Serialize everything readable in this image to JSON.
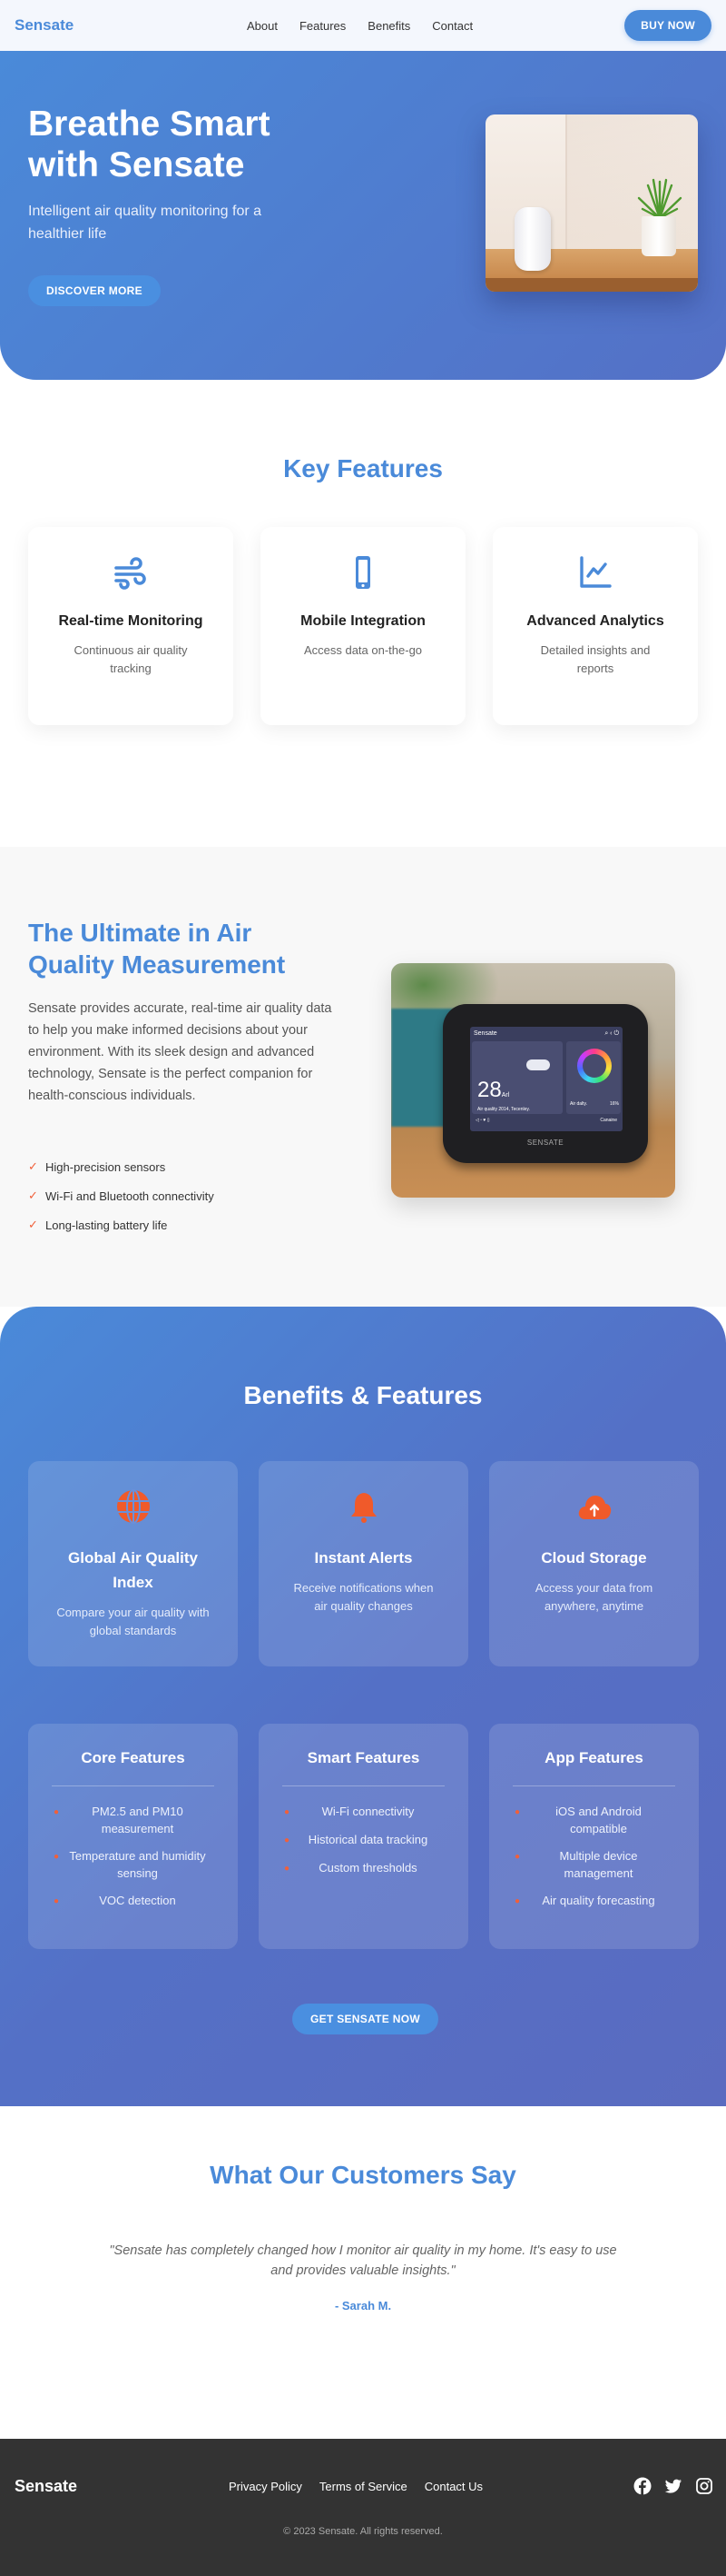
{
  "nav": {
    "logo": "Sensate",
    "links": [
      "About",
      "Features",
      "Benefits",
      "Contact"
    ],
    "buy_label": "BUY NOW"
  },
  "hero": {
    "title": "Breathe Smart with Sensate",
    "subtitle": "Intelligent air quality monitoring for a healthier life",
    "cta_label": "DISCOVER MORE",
    "image_alt": "White Sensate air monitor on a wooden desk beside a potted plant"
  },
  "key_features": {
    "title": "Key Features",
    "cards": [
      {
        "icon": "wind-icon",
        "title": "Real-time Monitoring",
        "desc": "Continuous air quality tracking"
      },
      {
        "icon": "mobile-phone-icon",
        "title": "Mobile Integration",
        "desc": "Access data on-the-go"
      },
      {
        "icon": "chart-line-icon",
        "title": "Advanced Analytics",
        "desc": "Detailed insights and reports"
      }
    ]
  },
  "ultimate": {
    "title": "The Ultimate in Air Quality Measurement",
    "description": "Sensate provides accurate, real-time air quality data to help you make informed decisions about your environment. With its sleek design and advanced technology, Sensate is the perfect companion for health-conscious individuals.",
    "checklist": [
      "High-precision sensors",
      "Wi-Fi and Bluetooth connectivity",
      "Long-lasting battery life"
    ],
    "device_screen": {
      "app_name": "Sensate",
      "reading": "28",
      "reading_unit": "Arl",
      "caption": "Air quality 2014, Tecenley.",
      "ring_label": "Air dalty.",
      "ring_value": "16%",
      "footer_label": "Canaine",
      "brand": "SENSATE"
    }
  },
  "benefits": {
    "title": "Benefits & Features",
    "cards": [
      {
        "icon": "globe-icon",
        "title": "Global Air Quality Index",
        "desc": "Compare your air quality with global standards"
      },
      {
        "icon": "bell-icon",
        "title": "Instant Alerts",
        "desc": "Receive notifications when air quality changes"
      },
      {
        "icon": "cloud-upload-icon",
        "title": "Cloud Storage",
        "desc": "Access your data from anywhere, anytime"
      }
    ],
    "lists": [
      {
        "title": "Core Features",
        "items": [
          "PM2.5 and PM10 measurement",
          "Temperature and humidity sensing",
          "VOC detection"
        ]
      },
      {
        "title": "Smart Features",
        "items": [
          "Wi-Fi connectivity",
          "Historical data tracking",
          "Custom thresholds"
        ]
      },
      {
        "title": "App Features",
        "items": [
          "iOS and Android compatible",
          "Multiple device management",
          "Air quality forecasting"
        ]
      }
    ],
    "cta_label": "GET SENSATE NOW"
  },
  "testimonials": {
    "title": "What Our Customers Say",
    "quote": "\"Sensate has completely changed how I monitor air quality in my home. It's easy to use and provides valuable insights.\"",
    "author": "- Sarah M."
  },
  "footer": {
    "logo": "Sensate",
    "links": [
      "Privacy Policy",
      "Terms of Service",
      "Contact Us"
    ],
    "social": [
      "facebook-icon",
      "twitter-icon",
      "instagram-icon"
    ],
    "copyright": "© 2023 Sensate. All rights reserved."
  },
  "colors": {
    "brand_blue": "#4a8ad9",
    "gradient_end": "#5470c6",
    "accent_orange": "#f0603a",
    "footer_bg": "#333333"
  }
}
